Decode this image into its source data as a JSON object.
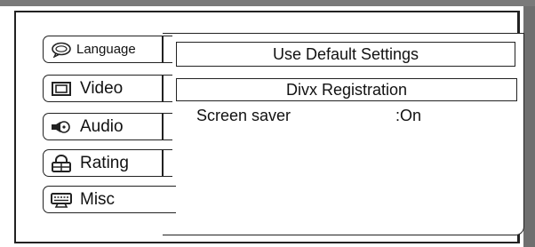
{
  "tabs": [
    {
      "label": "Language",
      "icon": "speech-bubble-icon"
    },
    {
      "label": "Video",
      "icon": "monitor-icon"
    },
    {
      "label": "Audio",
      "icon": "speaker-icon"
    },
    {
      "label": "Rating",
      "icon": "lock-icon"
    },
    {
      "label": "Misc",
      "icon": "keyboard-icon"
    }
  ],
  "active_tab": "Misc",
  "panel": {
    "default_button": "Use Default Settings",
    "divx_button": "Divx Registration",
    "screen_saver_label": "Screen saver",
    "screen_saver_value": ":On"
  }
}
